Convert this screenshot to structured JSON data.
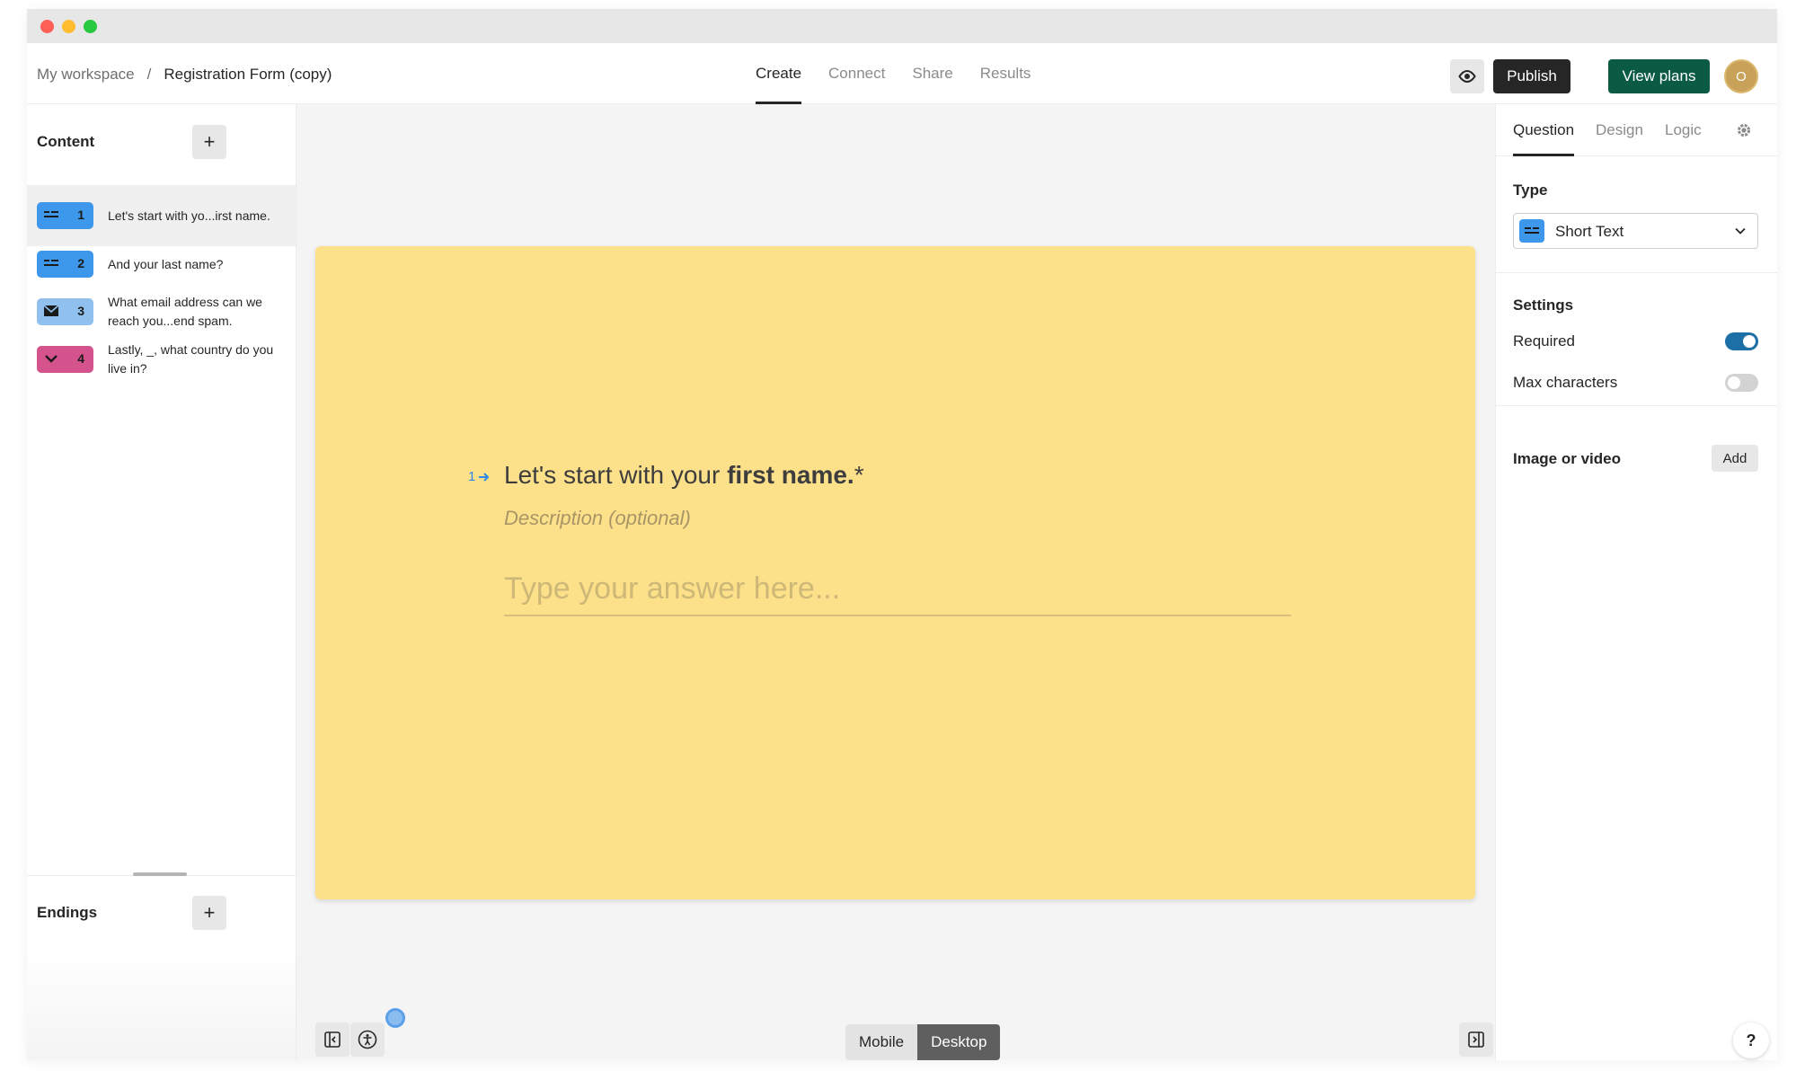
{
  "window": {
    "controls": [
      "close",
      "minimize",
      "maximize"
    ]
  },
  "header": {
    "breadcrumb": {
      "workspace": "My workspace",
      "separator": "/",
      "form_name": "Registration Form (copy)"
    },
    "tabs": [
      {
        "label": "Create",
        "active": true
      },
      {
        "label": "Connect",
        "active": false
      },
      {
        "label": "Share",
        "active": false
      },
      {
        "label": "Results",
        "active": false
      }
    ],
    "preview_icon": "eye-icon",
    "publish_label": "Publish",
    "view_plans_label": "View plans",
    "avatar_initial": "O"
  },
  "sidebar": {
    "content_title": "Content",
    "add_icon": "+",
    "welcome_icon": "welcome-screen-icon",
    "questions": [
      {
        "number": "1",
        "text": "Let's start with yo...irst name.",
        "type_icon": "short-text-icon",
        "color": "#3d97ea",
        "active": true
      },
      {
        "number": "2",
        "text": "And your last name?",
        "type_icon": "short-text-icon",
        "color": "#3d97ea",
        "active": false
      },
      {
        "number": "3",
        "text": "What email address can we reach you...end spam.",
        "type_icon": "envelope-icon",
        "color": "#8fc0ee",
        "active": false
      },
      {
        "number": "4",
        "text": "Lastly, _, what country do you live in?",
        "type_icon": "chevron-down-icon",
        "color": "#d5538c",
        "active": false
      }
    ],
    "endings_title": "Endings"
  },
  "canvas": {
    "card_color": "#fde08a",
    "question_number": "1",
    "question_prefix": "Let's start with your ",
    "question_bold": "first name.",
    "required_mark": "*",
    "description_placeholder": "Description (optional)",
    "answer_placeholder": "Type your answer here...",
    "device_options": [
      {
        "label": "Mobile",
        "selected": false
      },
      {
        "label": "Desktop",
        "selected": true
      }
    ]
  },
  "panel": {
    "tabs": [
      {
        "label": "Question",
        "active": true
      },
      {
        "label": "Design",
        "active": false
      },
      {
        "label": "Logic",
        "active": false
      }
    ],
    "type_label": "Type",
    "type_value": "Short Text",
    "settings_label": "Settings",
    "required_label": "Required",
    "required_on": true,
    "max_chars_label": "Max characters",
    "max_chars_on": false,
    "media_label": "Image or video",
    "add_label": "Add",
    "help_label": "?"
  },
  "colors": {
    "accent": "#0a5a44",
    "toggle_on": "#1d6fa8",
    "question_blue": "#3d97ea"
  }
}
